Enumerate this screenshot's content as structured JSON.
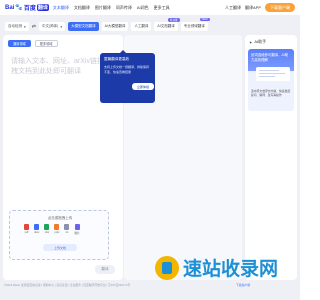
{
  "app": {
    "logo": {
      "bai": "Bai",
      "du": "百度",
      "fan": "翻译"
    },
    "nav": [
      "文本翻译",
      "文档翻译",
      "图片翻译",
      "同声传译",
      "AI润色",
      "更多工具"
    ],
    "top_right": {
      "human": "人工翻译",
      "client": "翻译APP",
      "vip": "下载客户端"
    }
  },
  "toolbar": {
    "source_lang": "自动检测",
    "target_lang": "中文(简体)",
    "swap_icon": "swap-icon",
    "tabs": [
      {
        "label": "大模型文档翻译",
        "primary": true
      },
      {
        "label": "AI大模型翻译"
      },
      {
        "label": "人工翻译"
      },
      {
        "label": "AI文档翻译",
        "badge": "新功能"
      },
      {
        "label": "专业领域翻译",
        "badge": "NEW"
      }
    ]
  },
  "left_panel": {
    "chips": [
      {
        "label": "通用领域",
        "on": true
      },
      {
        "label": "更多领域"
      }
    ],
    "placeholder": "请输入文本、网址、arXiv链接或拖拽文档到此处即可翻译",
    "upload": {
      "title": "点击或拖拽上传",
      "types": [
        {
          "label": "pdf",
          "color": "#e0463a"
        },
        {
          "label": "docx",
          "color": "#3c6ef5"
        },
        {
          "label": "xlsx",
          "color": "#1fa55b"
        },
        {
          "label": "pptx",
          "color": "#f07b2e"
        },
        {
          "label": "txt",
          "color": "#8b92a8"
        },
        {
          "label": "图片",
          "color": "#6b63f0"
        }
      ],
      "button": "上传文档"
    },
    "translate_button": "翻译"
  },
  "popup": {
    "title": "整篇翻译更高效",
    "body": "支持上传文档一键翻译，排版保持不变，快速查看结果",
    "button": "立即体验"
  },
  "ai_panel": {
    "title": "AI助手",
    "card_title": "划词选段即可翻译，AI助力高效理解",
    "card_desc": "选中原文或译文内容，快速发起提问、解释、改写等操作"
  },
  "footer": {
    "text": "©2024 Baidu 使用百度前必读 | 帮助中心 | 意见反馈 | 企业服务 | 百度翻译开放平台 | 京ICP证030173号",
    "right": "下载客户端"
  },
  "watermark": {
    "text": "速站收录网"
  }
}
